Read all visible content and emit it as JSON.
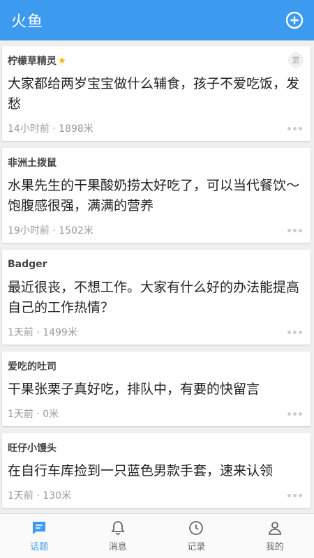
{
  "app": {
    "title": "火鱼",
    "accent_color": "#3d9bef",
    "add_icon": "plus-circle-icon"
  },
  "posts": [
    {
      "author": "柠檬草精灵",
      "starred": true,
      "reward_label": "赏",
      "content": "大家都给两岁宝宝做什么辅食，孩子不爱吃饭，发愁",
      "meta": "14小时前 · 1898米"
    },
    {
      "author": "非洲土拨鼠",
      "content": "水果先生的干果酸奶捞太好吃了，可以当代餐饮～饱腹感很强，满满的营养",
      "meta": "19小时前 · 1502米"
    },
    {
      "author": "Badger",
      "content": "最近很丧，不想工作。大家有什么好的办法能提高自己的工作热情？",
      "meta": "1天前 · 1499米"
    },
    {
      "author": "爱吃的吐司",
      "content": "干果张栗子真好吃，排队中，有要的快留言",
      "meta": "1天前 · 0米"
    },
    {
      "author": "旺仔小馒头",
      "content": "在自行车库捡到一只蓝色男款手套，速来认领",
      "meta": "1天前 · 130米"
    }
  ],
  "bottom_nav": [
    {
      "label": "话题",
      "icon": "chat-bubble-icon",
      "active": true
    },
    {
      "label": "消息",
      "icon": "bell-icon"
    },
    {
      "label": "记录",
      "icon": "clock-icon"
    },
    {
      "label": "我的",
      "icon": "person-icon"
    }
  ]
}
